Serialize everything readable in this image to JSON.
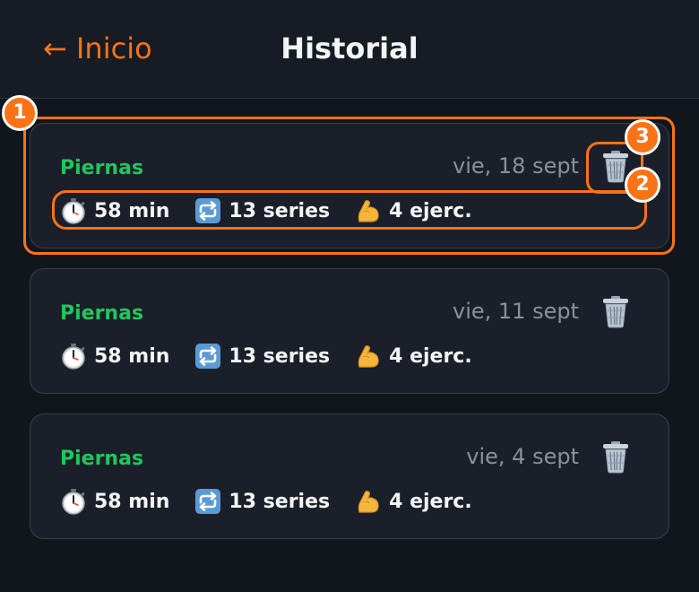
{
  "header": {
    "back_label": "← Inicio",
    "title": "Historial"
  },
  "workouts": [
    {
      "name": "Piernas",
      "date": "vie, 18 sept",
      "duration": "58 min",
      "series": "13 series",
      "exercises": "4 ejerc."
    },
    {
      "name": "Piernas",
      "date": "vie, 11 sept",
      "duration": "58 min",
      "series": "13 series",
      "exercises": "4 ejerc."
    },
    {
      "name": "Piernas",
      "date": "vie, 4 sept",
      "duration": "58 min",
      "series": "13 series",
      "exercises": "4 ejerc."
    }
  ],
  "icons": {
    "delete": "trash-icon",
    "duration": "stopwatch-icon",
    "series": "repeat-icon",
    "exercises": "flexed-biceps-icon"
  },
  "annotations": [
    "1",
    "2",
    "3"
  ],
  "colors": {
    "accent": "#f97316",
    "workout_name": "#22c55e",
    "background": "#11151c",
    "card": "#1a1f29"
  }
}
